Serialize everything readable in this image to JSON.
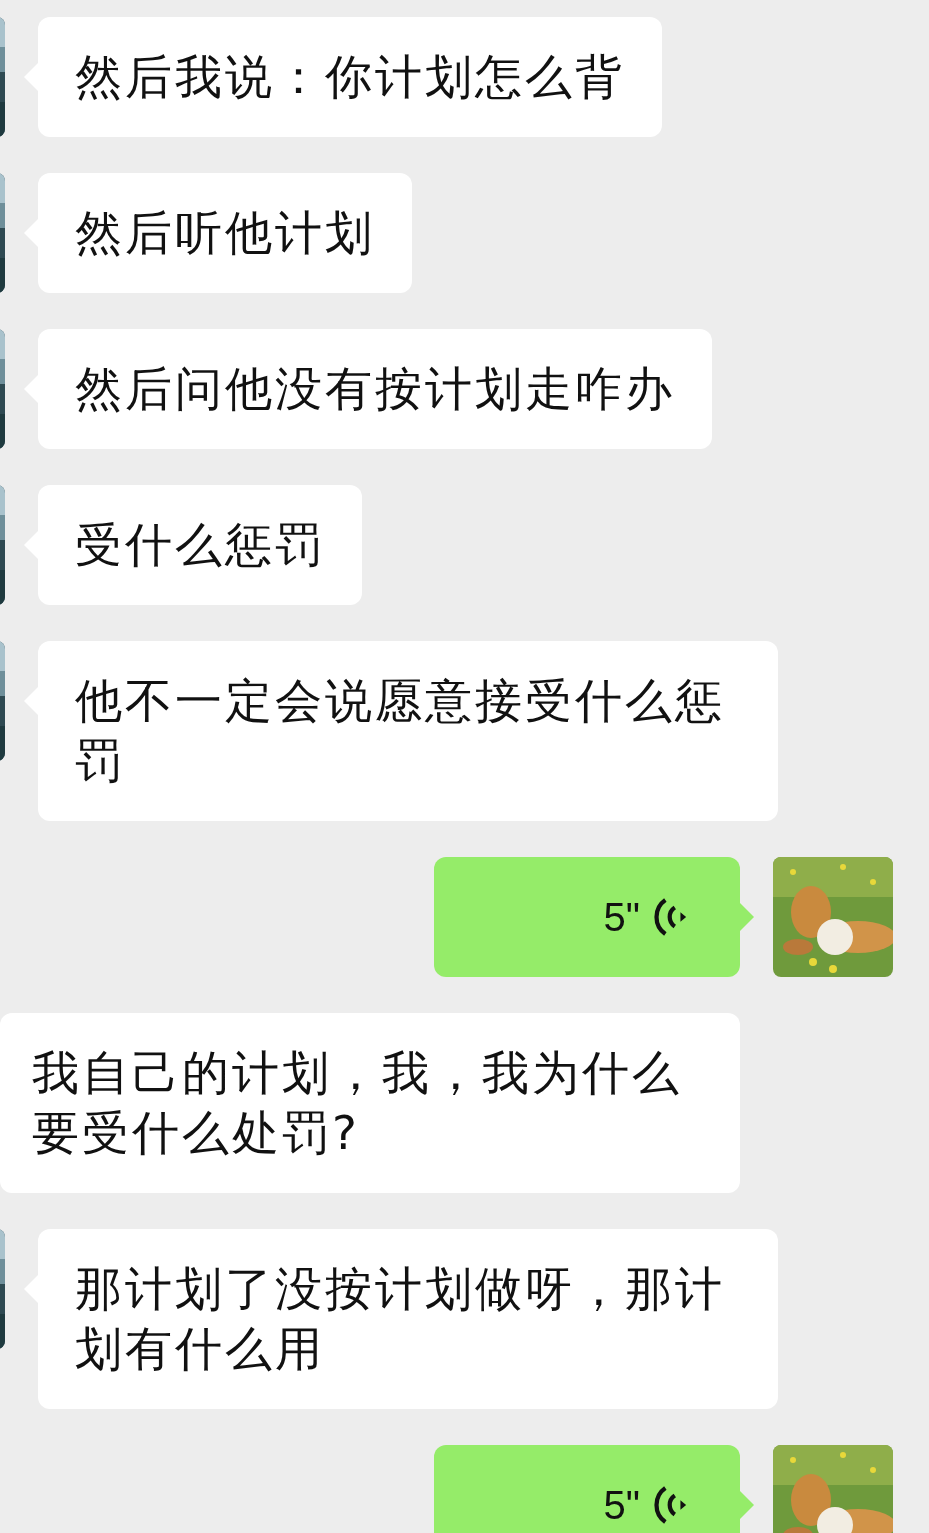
{
  "messages": [
    {
      "kind": "text",
      "text": "然后我说：你计划怎么背"
    },
    {
      "kind": "text",
      "text": "然后听他计划"
    },
    {
      "kind": "text",
      "text": "然后问他没有按计划走咋办"
    },
    {
      "kind": "text",
      "text": "受什么惩罚"
    },
    {
      "kind": "text",
      "text": "他不一定会说愿意接受什么惩罚"
    },
    {
      "kind": "voice",
      "duration": "5\""
    },
    {
      "kind": "transcript",
      "text": "我自己的计划，我，我为什么要受什么处罚?"
    },
    {
      "kind": "text",
      "text": "那计划了没按计划做呀，那计划有什么用"
    },
    {
      "kind": "voice",
      "duration": "5\""
    }
  ]
}
